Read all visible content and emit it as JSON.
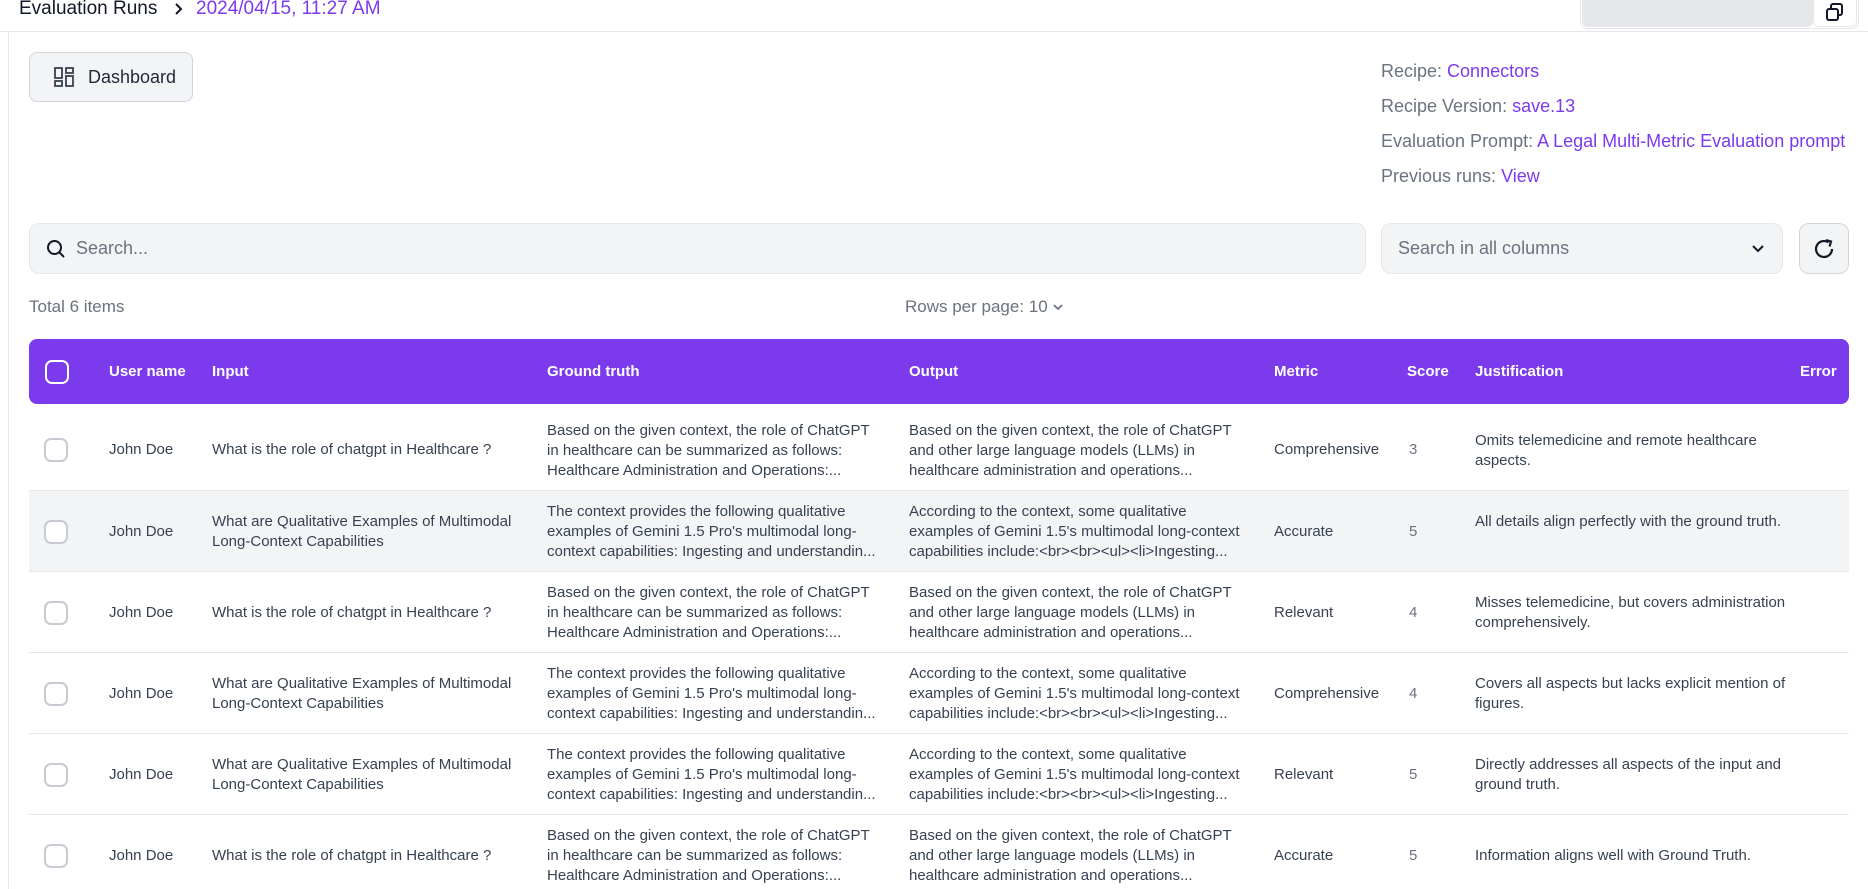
{
  "breadcrumb": {
    "root": "Evaluation Runs",
    "current": "2024/04/15, 11:27 AM"
  },
  "dashboard_button": {
    "label": "Dashboard"
  },
  "recipe_info": {
    "recipe_label": "Recipe:",
    "recipe_value": "Connectors",
    "version_label": "Recipe Version:",
    "version_value": "save.13",
    "prompt_label": "Evaluation Prompt:",
    "prompt_value": "A Legal Multi-Metric Evaluation prompt",
    "previous_label": "Previous runs:",
    "previous_value": "View"
  },
  "search": {
    "placeholder": "Search..."
  },
  "column_select": {
    "value": "Search in all columns"
  },
  "summary": {
    "total": "Total 6 items",
    "rows_per_page": "Rows per page: 10"
  },
  "table": {
    "headers": {
      "user": "User name",
      "input": "Input",
      "ground_truth": "Ground truth",
      "output": "Output",
      "metric": "Metric",
      "score": "Score",
      "justification": "Justification",
      "error": "Error"
    },
    "rows": [
      {
        "user": "John Doe",
        "input": "What is the role of chatgpt in Healthcare ?",
        "gt1": "Based on the given context, the role of ChatGPT",
        "gt2": "in healthcare can be summarized as follows:",
        "gt3": "Healthcare Administration and Operations:...",
        "out1": "Based on the given context, the role of ChatGPT",
        "out2": "and other large language models (LLMs) in",
        "out3": "healthcare administration and operations...",
        "metric": "Comprehensive",
        "score": "3",
        "just": "Omits telemedicine and remote healthcare aspects."
      },
      {
        "user": "John Doe",
        "input": "What are Qualitative Examples of Multimodal Long-Context Capabilities",
        "gt1": "The context provides the following qualitative",
        "gt2": "examples of Gemini 1.5 Pro's multimodal long-",
        "gt3": "context capabilities: Ingesting and understandin...",
        "out1": "According to the context, some qualitative",
        "out2": "examples of Gemini 1.5's multimodal long-context",
        "out3": "capabilities include:<br><br><ul><li>Ingesting...",
        "metric": "Accurate",
        "score": "5",
        "just": "All details align perfectly with the ground truth."
      },
      {
        "user": "John Doe",
        "input": "What is the role of chatgpt in Healthcare ?",
        "gt1": "Based on the given context, the role of ChatGPT",
        "gt2": "in healthcare can be summarized as follows:",
        "gt3": "Healthcare Administration and Operations:...",
        "out1": "Based on the given context, the role of ChatGPT",
        "out2": "and other large language models (LLMs) in",
        "out3": "healthcare administration and operations...",
        "metric": "Relevant",
        "score": "4",
        "just": "Misses telemedicine, but covers administration comprehensively."
      },
      {
        "user": "John Doe",
        "input": "What are Qualitative Examples of Multimodal Long-Context Capabilities",
        "gt1": "The context provides the following qualitative",
        "gt2": "examples of Gemini 1.5 Pro's multimodal long-",
        "gt3": "context capabilities: Ingesting and understandin...",
        "out1": "According to the context, some qualitative",
        "out2": "examples of Gemini 1.5's multimodal long-context",
        "out3": "capabilities include:<br><br><ul><li>Ingesting...",
        "metric": "Comprehensive",
        "score": "4",
        "just": "Covers all aspects but lacks explicit mention of figures."
      },
      {
        "user": "John Doe",
        "input": "What are Qualitative Examples of Multimodal Long-Context Capabilities",
        "gt1": "The context provides the following qualitative",
        "gt2": "examples of Gemini 1.5 Pro's multimodal long-",
        "gt3": "context capabilities: Ingesting and understandin...",
        "out1": "According to the context, some qualitative",
        "out2": "examples of Gemini 1.5's multimodal long-context",
        "out3": "capabilities include:<br><br><ul><li>Ingesting...",
        "metric": "Relevant",
        "score": "5",
        "just": "Directly addresses all aspects of the input and ground truth."
      },
      {
        "user": "John Doe",
        "input": "What is the role of chatgpt in Healthcare ?",
        "gt1": "Based on the given context, the role of ChatGPT",
        "gt2": "in healthcare can be summarized as follows:",
        "gt3": "Healthcare Administration and Operations:...",
        "out1": "Based on the given context, the role of ChatGPT",
        "out2": "and other large language models (LLMs) in",
        "out3": "healthcare administration and operations...",
        "metric": "Accurate",
        "score": "5",
        "just": "Information aligns well with Ground Truth."
      }
    ]
  },
  "colors": {
    "accent": "#7c3aed",
    "row_alt": "#f3f4f6"
  }
}
